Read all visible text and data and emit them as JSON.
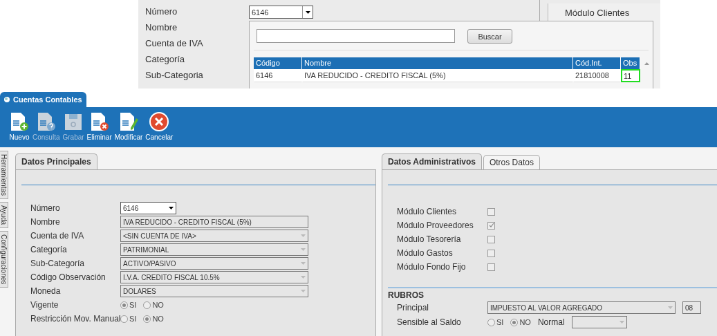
{
  "inset": {
    "labels": [
      "Número",
      "Nombre",
      "Cuenta de IVA",
      "Categoría",
      "Sub-Categoria"
    ],
    "numero_value": "6146",
    "popup": {
      "search_button": "Buscar",
      "columns": [
        "Código",
        "Nombre",
        "Cód.Int.",
        "Obs"
      ],
      "rows": [
        {
          "cells": [
            {
              "text": "6146",
              "highlighted": false
            },
            {
              "text": "IVA REDUCIDO - CREDITO FISCAL (5%)",
              "highlighted": false
            },
            {
              "text": "21810008",
              "highlighted": false
            },
            {
              "text": "11",
              "highlighted": true
            }
          ]
        }
      ]
    },
    "side_label": "Módulo Clientes"
  },
  "window": {
    "title": "Cuentas Contables"
  },
  "toolbar": [
    {
      "label": "Nuevo",
      "kind": "new",
      "disabled": false
    },
    {
      "label": "Consulta",
      "kind": "query",
      "disabled": true
    },
    {
      "label": "Grabar",
      "kind": "save",
      "disabled": true
    },
    {
      "label": "Eliminar",
      "kind": "delete",
      "disabled": false
    },
    {
      "label": "Modificar",
      "kind": "edit",
      "disabled": false
    },
    {
      "label": "Cancelar",
      "kind": "cancel",
      "disabled": false
    }
  ],
  "side_tabs": [
    "Herramientas",
    "Ayuda",
    "Configuraciones"
  ],
  "left_panel": {
    "tabs": [
      {
        "label": "Datos Principales",
        "selected": true
      }
    ],
    "fields": [
      {
        "label": "Número",
        "kind": "combo",
        "value": "6146"
      },
      {
        "label": "Nombre",
        "kind": "text",
        "value": "IVA REDUCIDO - CREDITO FISCAL (5%)"
      },
      {
        "label": "Cuenta de IVA",
        "kind": "select",
        "value": "<SIN CUENTA DE IVA>"
      },
      {
        "label": "Categoría",
        "kind": "select",
        "value": "PATRIMONIAL"
      },
      {
        "label": "Sub-Categoría",
        "kind": "select",
        "value": "ACTIVO/PASIVO"
      },
      {
        "label": "Código Observación",
        "kind": "select",
        "value": "I.V.A. CREDITO FISCAL 10.5%"
      },
      {
        "label": "Moneda",
        "kind": "select",
        "value": "DOLARES"
      },
      {
        "label": "Vigente",
        "kind": "radio",
        "options": [
          {
            "label": "SI",
            "selected": true
          },
          {
            "label": "NO",
            "selected": false
          }
        ]
      },
      {
        "label": "Restricción Mov. Manual",
        "kind": "radio",
        "options": [
          {
            "label": "SI",
            "selected": false
          },
          {
            "label": "NO",
            "selected": true
          }
        ]
      }
    ]
  },
  "right_panel": {
    "tabs": [
      {
        "label": "Datos Administrativos",
        "selected": true
      },
      {
        "label": "Otros Datos",
        "selected": false
      }
    ],
    "modules": [
      {
        "label": "Módulo Clientes",
        "checked": false
      },
      {
        "label": "Módulo Proveedores",
        "checked": true
      },
      {
        "label": "Módulo Tesorería",
        "checked": false
      },
      {
        "label": "Módulo Gastos",
        "checked": false
      },
      {
        "label": "Módulo Fondo Fijo",
        "checked": false
      }
    ],
    "rubros": {
      "title": "RUBROS",
      "principal": {
        "label": "Principal",
        "value": "IMPUESTO AL VALOR AGREGADO",
        "code": "08"
      },
      "sensible": {
        "label": "Sensible al Saldo",
        "options": [
          {
            "label": "SI",
            "selected": false
          },
          {
            "label": "NO",
            "selected": true
          }
        ],
        "normal_label": "Normal"
      }
    }
  }
}
